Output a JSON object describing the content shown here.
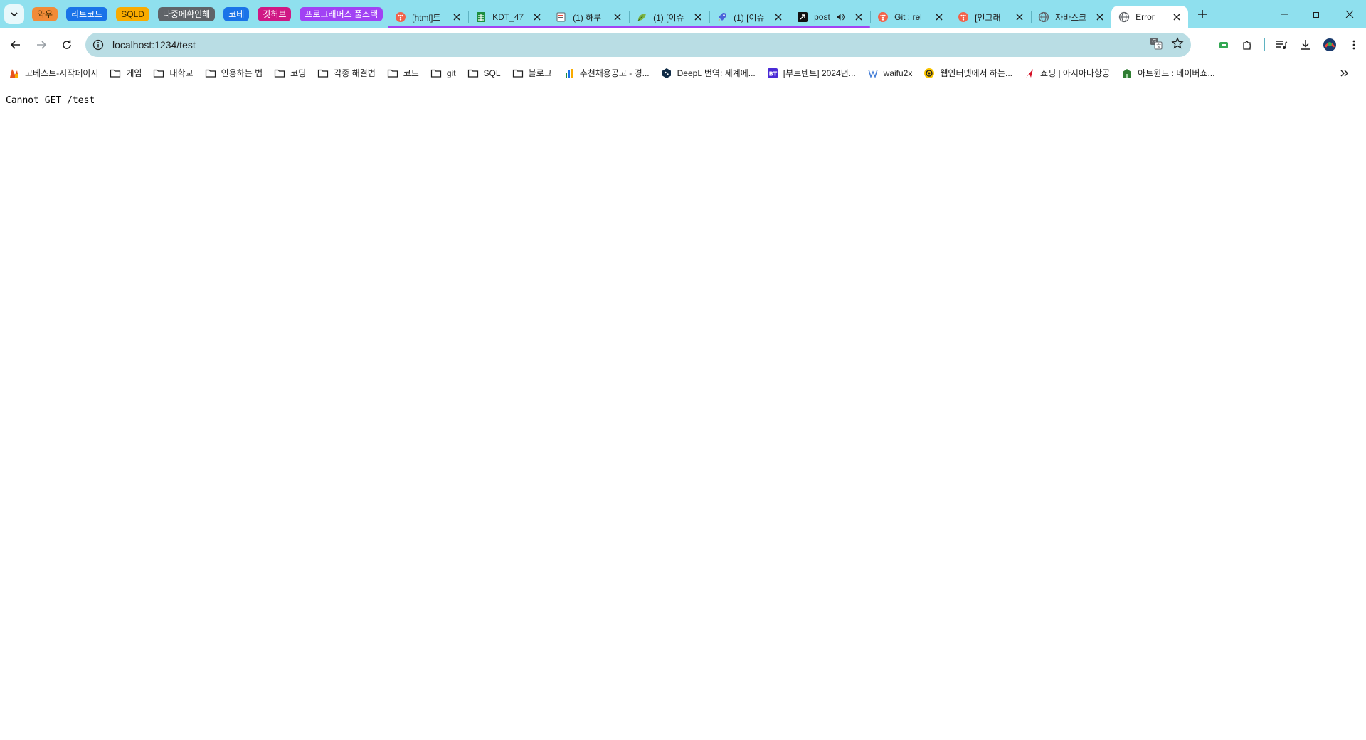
{
  "colors": {
    "tabstrip_bg": "#8fe0ee",
    "omnibox_bg": "#b9dde4",
    "active_tab_bg": "#ffffff"
  },
  "tab_groups": [
    {
      "label": "와우",
      "color": "#f28b38"
    },
    {
      "label": "리트코드",
      "color": "#1a73e8"
    },
    {
      "label": "SQLD",
      "color": "#f9ab00"
    },
    {
      "label": "나중에확인해",
      "color": "#5f6368"
    },
    {
      "label": "코테",
      "color": "#1a73e8"
    },
    {
      "label": "깃허브",
      "color": "#d01884"
    },
    {
      "label": "프로그래머스 풀스택",
      "color": "#a142f4"
    }
  ],
  "tabs": [
    {
      "title": "[html]트",
      "icon": "tistory-icon"
    },
    {
      "title": "KDT_47",
      "icon": "sheets-icon"
    },
    {
      "title": "(1) 하루",
      "icon": "doc-icon"
    },
    {
      "title": "(1) [이슈",
      "icon": "leaf-icon"
    },
    {
      "title": "(1) [이슈",
      "icon": "rocket-icon"
    },
    {
      "title": "post",
      "icon": "notion-icon"
    },
    {
      "title": "Git : rel",
      "icon": "tistory-icon"
    },
    {
      "title": "[언그래",
      "icon": "tistory-icon"
    },
    {
      "title": "자바스크",
      "icon": "globe-icon"
    },
    {
      "title": "Error",
      "icon": "globe-icon"
    }
  ],
  "address_bar": {
    "url": "localhost:1234/test"
  },
  "bookmarks": [
    {
      "label": "고베스트-시작페이지",
      "icon": "site-icon"
    },
    {
      "label": "게임",
      "icon": "folder-icon"
    },
    {
      "label": "대학교",
      "icon": "folder-icon"
    },
    {
      "label": "인용하는 법",
      "icon": "folder-icon"
    },
    {
      "label": "코딩",
      "icon": "folder-icon"
    },
    {
      "label": "각종 해결법",
      "icon": "folder-icon"
    },
    {
      "label": "코드",
      "icon": "folder-icon"
    },
    {
      "label": "git",
      "icon": "folder-icon"
    },
    {
      "label": "SQL",
      "icon": "folder-icon"
    },
    {
      "label": "블로그",
      "icon": "folder-icon"
    },
    {
      "label": "추천채용공고 - 경...",
      "icon": "chart-icon"
    },
    {
      "label": "DeepL 번역: 세계에...",
      "icon": "deepl-icon"
    },
    {
      "label": "[부트텐트] 2024년...",
      "icon": "bt-icon"
    },
    {
      "label": "waifu2x",
      "icon": "w-icon"
    },
    {
      "label": "웹인터넷에서 하는...",
      "icon": "smile-icon"
    },
    {
      "label": "쇼핑 | 아시아나항공",
      "icon": "asiana-icon"
    },
    {
      "label": "아트윈드 : 네이버쇼...",
      "icon": "shop-icon"
    }
  ],
  "page": {
    "body_text": "Cannot GET /test"
  }
}
